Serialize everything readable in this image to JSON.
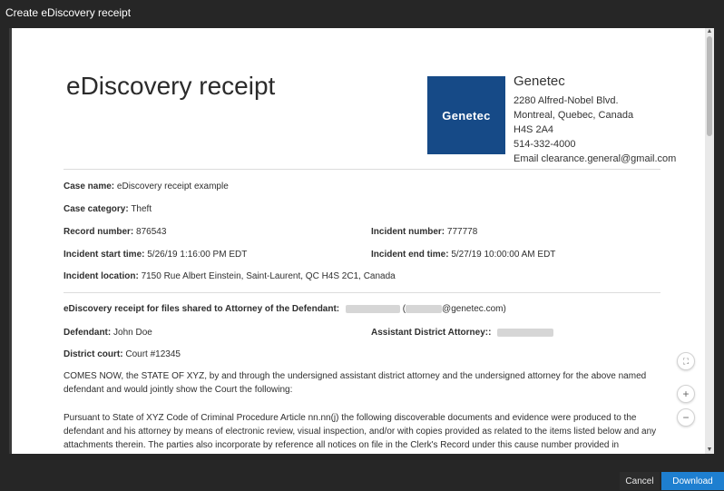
{
  "window": {
    "title": "Create eDiscovery receipt"
  },
  "document": {
    "title": "eDiscovery receipt",
    "logo_text": "Genetec",
    "company": {
      "name": "Genetec",
      "address1": "2280 Alfred-Nobel Blvd.",
      "address2": "Montreal, Quebec, Canada",
      "postal": "H4S 2A4",
      "phone": "514-332-4000",
      "email": "Email clearance.general@gmail.com"
    },
    "case_name_label": "Case name:",
    "case_name": "eDiscovery receipt example",
    "case_category_label": "Case category:",
    "case_category": "Theft",
    "record_number_label": "Record number:",
    "record_number": "876543",
    "incident_number_label": "Incident number:",
    "incident_number": "777778",
    "incident_start_label": "Incident start time:",
    "incident_start": "5/26/19 1:16:00 PM EDT",
    "incident_end_label": "Incident end time:",
    "incident_end": "5/27/19 10:00:00 AM EDT",
    "incident_location_label": "Incident location:",
    "incident_location": "7150 Rue Albert Einstein, Saint-Laurent, QC H4S 2C1, Canada",
    "shared_label": "eDiscovery receipt for files shared to Attorney of the Defendant:",
    "shared_email_open": "(",
    "shared_email_domain": "@genetec.com)",
    "defendant_label": "Defendant:",
    "defendant": "John Doe",
    "ada_label": "Assistant District Attorney::",
    "court_label": "District court:",
    "court": "Court #12345",
    "para1": "COMES NOW, the STATE OF XYZ, by and through the undersigned assistant district attorney and the undersigned attorney for the above named defendant and would jointly show the Court the following:",
    "para2": "Pursuant to State of XYZ Code of Criminal Procedure Article nn.nn(j) the following discoverable documents and evidence were produced to the defendant and his attorney by means of electronic review, visual inspection, and/or with copies provided as related to the items listed below and any attachments therein.  The parties also incorporate by reference all notices on file in the Clerk's Record under this cause number provided in"
  },
  "zoom": {
    "fit_icon": "fit-to-page-icon",
    "in_icon": "zoom-in-icon",
    "out_icon": "zoom-out-icon",
    "fit": "⛶",
    "plus": "+",
    "minus": "−"
  },
  "footer": {
    "cancel": "Cancel",
    "download": "Download"
  },
  "colors": {
    "accent": "#1e7fd0",
    "logo_bg": "#164a87",
    "chrome": "#262626"
  }
}
